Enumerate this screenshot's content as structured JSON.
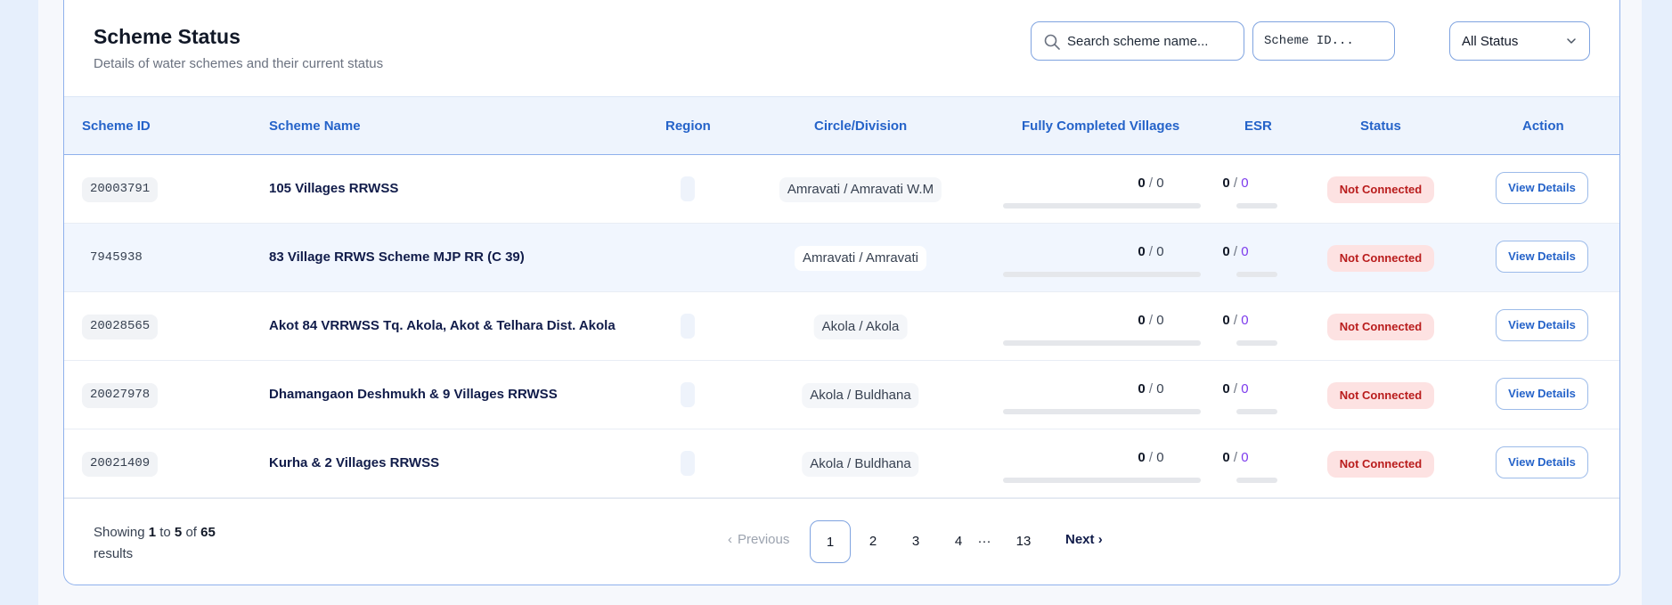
{
  "header": {
    "title": "Scheme Status",
    "subtitle": "Details of water schemes and their current status"
  },
  "filters": {
    "search_placeholder": "Search scheme name...",
    "id_placeholder": "Scheme ID...",
    "status_value": "All Status"
  },
  "columns": {
    "scheme_id": "Scheme ID",
    "scheme_name": "Scheme Name",
    "region": "Region",
    "circle_division": "Circle/Division",
    "fully_completed_villages": "Fully Completed Villages",
    "esr": "ESR",
    "status": "Status",
    "action": "Action"
  },
  "rows": [
    {
      "id": "20003791",
      "name": "105 Villages RRWSS",
      "circle": "Amravati / Amravati W.M",
      "villages_done": "0",
      "villages_total": "0",
      "esr_done": "0",
      "esr_total": "0",
      "status": "Not Connected",
      "action": "View Details"
    },
    {
      "id": "7945938",
      "name": "83 Village RRWS Scheme MJP RR (C 39)",
      "circle": "Amravati / Amravati",
      "villages_done": "0",
      "villages_total": "0",
      "esr_done": "0",
      "esr_total": "0",
      "status": "Not Connected",
      "action": "View Details"
    },
    {
      "id": "20028565",
      "name": "Akot 84 VRRWSS Tq. Akola, Akot & Telhara Dist. Akola",
      "circle": "Akola / Akola",
      "villages_done": "0",
      "villages_total": "0",
      "esr_done": "0",
      "esr_total": "0",
      "status": "Not Connected",
      "action": "View Details"
    },
    {
      "id": "20027978",
      "name": "Dhamangaon Deshmukh & 9 Villages RRWSS",
      "circle": "Akola / Buldhana",
      "villages_done": "0",
      "villages_total": "0",
      "esr_done": "0",
      "esr_total": "0",
      "status": "Not Connected",
      "action": "View Details"
    },
    {
      "id": "20021409",
      "name": "Kurha & 2 Villages RRWSS",
      "circle": "Akola / Buldhana",
      "villages_done": "0",
      "villages_total": "0",
      "esr_done": "0",
      "esr_total": "0",
      "status": "Not Connected",
      "action": "View Details"
    }
  ],
  "footer": {
    "showing_prefix": "Showing",
    "from": "1",
    "to_word": "to",
    "to": "5",
    "of_word": "of",
    "total": "65",
    "results_word": "results"
  },
  "pagination": {
    "previous": "Previous",
    "pages": [
      "1",
      "2",
      "3",
      "4"
    ],
    "ellipsis": "···",
    "last": "13",
    "next": "Next",
    "current": "1"
  },
  "colors": {
    "accent": "#2563c9",
    "status_bg": "#fde2e2",
    "status_text": "#b91c1c",
    "esr_total": "#7c3aed"
  }
}
